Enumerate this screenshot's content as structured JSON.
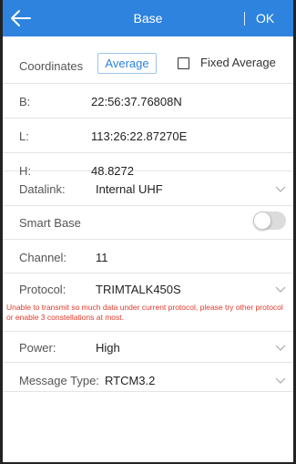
{
  "header": {
    "title": "Base",
    "ok_label": "OK"
  },
  "coordinates": {
    "label": "Coordinates",
    "average_button": "Average",
    "fixed_average_label": "Fixed Average",
    "fixed_average_checked": false
  },
  "fields": {
    "b": {
      "label": "B:",
      "value": "22:56:37.76808N"
    },
    "l": {
      "label": "L:",
      "value": "113:26:22.87270E"
    },
    "h": {
      "label": "H:",
      "value": "48.8272"
    },
    "datalink": {
      "label": "Datalink:",
      "value": "Internal UHF"
    },
    "smart_base": {
      "label": "Smart Base",
      "enabled": false
    },
    "channel": {
      "label": "Channel:",
      "value": "11"
    },
    "protocol": {
      "label": "Protocol:",
      "value": "TRIMTALK450S"
    },
    "warning": "Unable to transmit so much data under current protocol, please try other protocol or enable 3 constellations at most.",
    "power": {
      "label": "Power:",
      "value": "High"
    },
    "message_type": {
      "label": "Message Type:",
      "value": "RTCM3.2"
    }
  },
  "icons": {
    "back": "arrow-left-icon",
    "dropdown": "chevron-down-icon"
  },
  "colors": {
    "header": "#2d83de",
    "accent": "#2d83de",
    "warning": "#e03a2c"
  }
}
